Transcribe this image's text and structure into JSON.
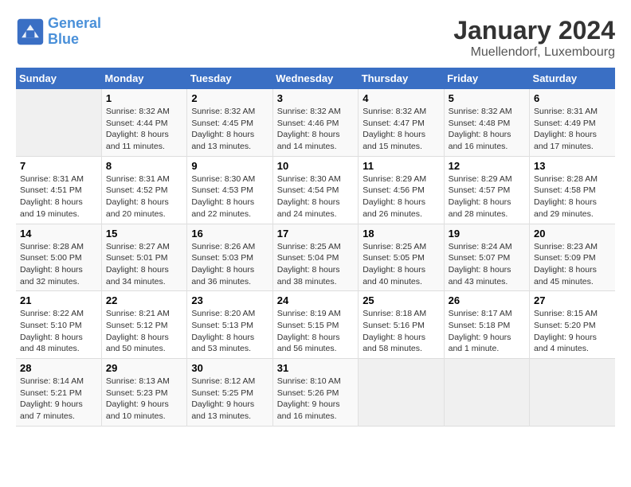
{
  "header": {
    "logo_line1": "General",
    "logo_line2": "Blue",
    "month": "January 2024",
    "location": "Muellendorf, Luxembourg"
  },
  "weekdays": [
    "Sunday",
    "Monday",
    "Tuesday",
    "Wednesday",
    "Thursday",
    "Friday",
    "Saturday"
  ],
  "weeks": [
    [
      {
        "day": "",
        "info": ""
      },
      {
        "day": "1",
        "info": "Sunrise: 8:32 AM\nSunset: 4:44 PM\nDaylight: 8 hours\nand 11 minutes."
      },
      {
        "day": "2",
        "info": "Sunrise: 8:32 AM\nSunset: 4:45 PM\nDaylight: 8 hours\nand 13 minutes."
      },
      {
        "day": "3",
        "info": "Sunrise: 8:32 AM\nSunset: 4:46 PM\nDaylight: 8 hours\nand 14 minutes."
      },
      {
        "day": "4",
        "info": "Sunrise: 8:32 AM\nSunset: 4:47 PM\nDaylight: 8 hours\nand 15 minutes."
      },
      {
        "day": "5",
        "info": "Sunrise: 8:32 AM\nSunset: 4:48 PM\nDaylight: 8 hours\nand 16 minutes."
      },
      {
        "day": "6",
        "info": "Sunrise: 8:31 AM\nSunset: 4:49 PM\nDaylight: 8 hours\nand 17 minutes."
      }
    ],
    [
      {
        "day": "7",
        "info": "Sunrise: 8:31 AM\nSunset: 4:51 PM\nDaylight: 8 hours\nand 19 minutes."
      },
      {
        "day": "8",
        "info": "Sunrise: 8:31 AM\nSunset: 4:52 PM\nDaylight: 8 hours\nand 20 minutes."
      },
      {
        "day": "9",
        "info": "Sunrise: 8:30 AM\nSunset: 4:53 PM\nDaylight: 8 hours\nand 22 minutes."
      },
      {
        "day": "10",
        "info": "Sunrise: 8:30 AM\nSunset: 4:54 PM\nDaylight: 8 hours\nand 24 minutes."
      },
      {
        "day": "11",
        "info": "Sunrise: 8:29 AM\nSunset: 4:56 PM\nDaylight: 8 hours\nand 26 minutes."
      },
      {
        "day": "12",
        "info": "Sunrise: 8:29 AM\nSunset: 4:57 PM\nDaylight: 8 hours\nand 28 minutes."
      },
      {
        "day": "13",
        "info": "Sunrise: 8:28 AM\nSunset: 4:58 PM\nDaylight: 8 hours\nand 29 minutes."
      }
    ],
    [
      {
        "day": "14",
        "info": "Sunrise: 8:28 AM\nSunset: 5:00 PM\nDaylight: 8 hours\nand 32 minutes."
      },
      {
        "day": "15",
        "info": "Sunrise: 8:27 AM\nSunset: 5:01 PM\nDaylight: 8 hours\nand 34 minutes."
      },
      {
        "day": "16",
        "info": "Sunrise: 8:26 AM\nSunset: 5:03 PM\nDaylight: 8 hours\nand 36 minutes."
      },
      {
        "day": "17",
        "info": "Sunrise: 8:25 AM\nSunset: 5:04 PM\nDaylight: 8 hours\nand 38 minutes."
      },
      {
        "day": "18",
        "info": "Sunrise: 8:25 AM\nSunset: 5:05 PM\nDaylight: 8 hours\nand 40 minutes."
      },
      {
        "day": "19",
        "info": "Sunrise: 8:24 AM\nSunset: 5:07 PM\nDaylight: 8 hours\nand 43 minutes."
      },
      {
        "day": "20",
        "info": "Sunrise: 8:23 AM\nSunset: 5:09 PM\nDaylight: 8 hours\nand 45 minutes."
      }
    ],
    [
      {
        "day": "21",
        "info": "Sunrise: 8:22 AM\nSunset: 5:10 PM\nDaylight: 8 hours\nand 48 minutes."
      },
      {
        "day": "22",
        "info": "Sunrise: 8:21 AM\nSunset: 5:12 PM\nDaylight: 8 hours\nand 50 minutes."
      },
      {
        "day": "23",
        "info": "Sunrise: 8:20 AM\nSunset: 5:13 PM\nDaylight: 8 hours\nand 53 minutes."
      },
      {
        "day": "24",
        "info": "Sunrise: 8:19 AM\nSunset: 5:15 PM\nDaylight: 8 hours\nand 56 minutes."
      },
      {
        "day": "25",
        "info": "Sunrise: 8:18 AM\nSunset: 5:16 PM\nDaylight: 8 hours\nand 58 minutes."
      },
      {
        "day": "26",
        "info": "Sunrise: 8:17 AM\nSunset: 5:18 PM\nDaylight: 9 hours\nand 1 minute."
      },
      {
        "day": "27",
        "info": "Sunrise: 8:15 AM\nSunset: 5:20 PM\nDaylight: 9 hours\nand 4 minutes."
      }
    ],
    [
      {
        "day": "28",
        "info": "Sunrise: 8:14 AM\nSunset: 5:21 PM\nDaylight: 9 hours\nand 7 minutes."
      },
      {
        "day": "29",
        "info": "Sunrise: 8:13 AM\nSunset: 5:23 PM\nDaylight: 9 hours\nand 10 minutes."
      },
      {
        "day": "30",
        "info": "Sunrise: 8:12 AM\nSunset: 5:25 PM\nDaylight: 9 hours\nand 13 minutes."
      },
      {
        "day": "31",
        "info": "Sunrise: 8:10 AM\nSunset: 5:26 PM\nDaylight: 9 hours\nand 16 minutes."
      },
      {
        "day": "",
        "info": ""
      },
      {
        "day": "",
        "info": ""
      },
      {
        "day": "",
        "info": ""
      }
    ]
  ]
}
